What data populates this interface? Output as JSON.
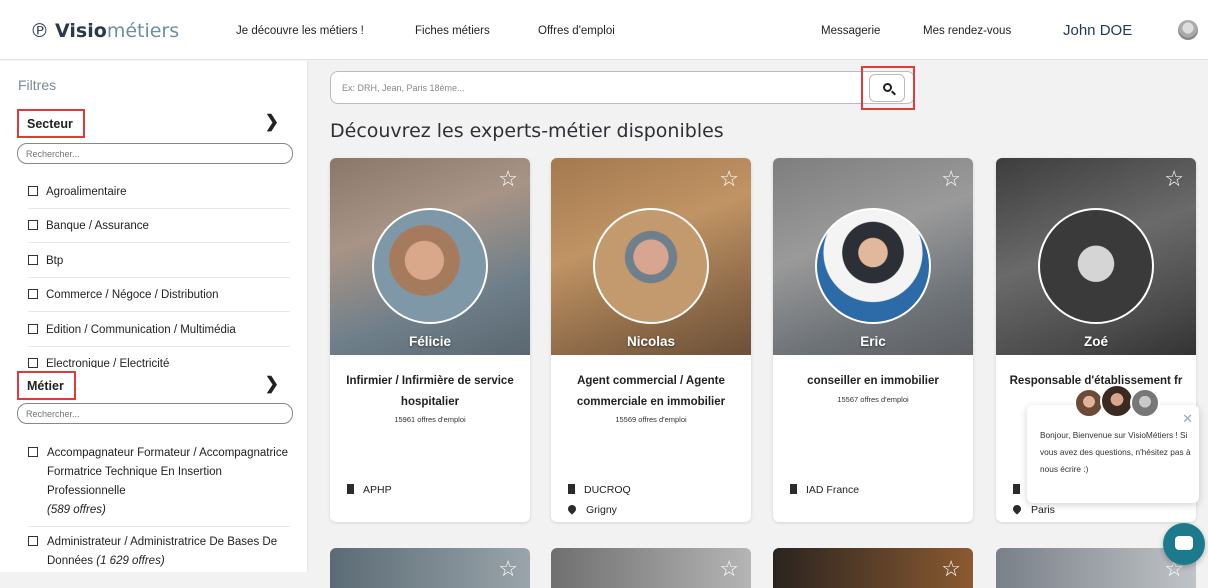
{
  "header": {
    "logo_prefix": "Visio",
    "logo_suffix": "métiers",
    "nav": [
      "Je découvre les métiers !",
      "Fiches métiers",
      "Offres d'emploi",
      "Messagerie",
      "Mes rendez-vous"
    ],
    "user_name": "John DOE"
  },
  "sidebar": {
    "title": "Filtres",
    "secteur_label": "Secteur",
    "secteur_search_placeholder": "Rechercher...",
    "secteur_items": [
      "Agroalimentaire",
      "Banque / Assurance",
      "Btp",
      "Commerce / Négoce / Distribution",
      "Edition / Communication / Multimédia",
      "Electronique / Électricité"
    ],
    "metier_label": "Métier",
    "metier_search_placeholder": "Rechercher...",
    "metier_items": [
      {
        "name": "Accompagnateur Formateur / Accompagnatrice Formatrice Technique En Insertion Professionnelle",
        "count": "(589 offres)"
      },
      {
        "name": "Administrateur / Administratrice De Bases De Données",
        "count": "(1 629 offres)"
      }
    ]
  },
  "main": {
    "search_placeholder": "Ex: DRH, Jean, Paris 18ème...",
    "heading": "Découvrez les experts-métier disponibles",
    "cards": [
      {
        "name": "Félicie",
        "job": "Infirmier / Infirmière de service hospitalier",
        "offers": "15961 offres d'emploi",
        "company": "APHP",
        "city": ""
      },
      {
        "name": "Nicolas",
        "job": "Agent commercial / Agente commerciale en immobilier",
        "offers": "15569 offres d'emploi",
        "company": "DUCROQ",
        "city": "Grigny"
      },
      {
        "name": "Eric",
        "job": "conseiller en immobilier",
        "offers": "15567 offres d'emploi",
        "company": "IAD France",
        "city": ""
      },
      {
        "name": "Zoé",
        "job": "Responsable d'établissement fr",
        "offers": "",
        "company": "",
        "city": "Paris"
      }
    ]
  },
  "chat": {
    "message": "Bonjour, Bienvenue sur VisioMétiers ! Si vous avez des questions, n'hésitez pas à nous écrire :)"
  },
  "colors": {
    "highlight": "#e03a3a",
    "chat_button": "#1d7a8c",
    "brand": "#2b3a4a"
  }
}
